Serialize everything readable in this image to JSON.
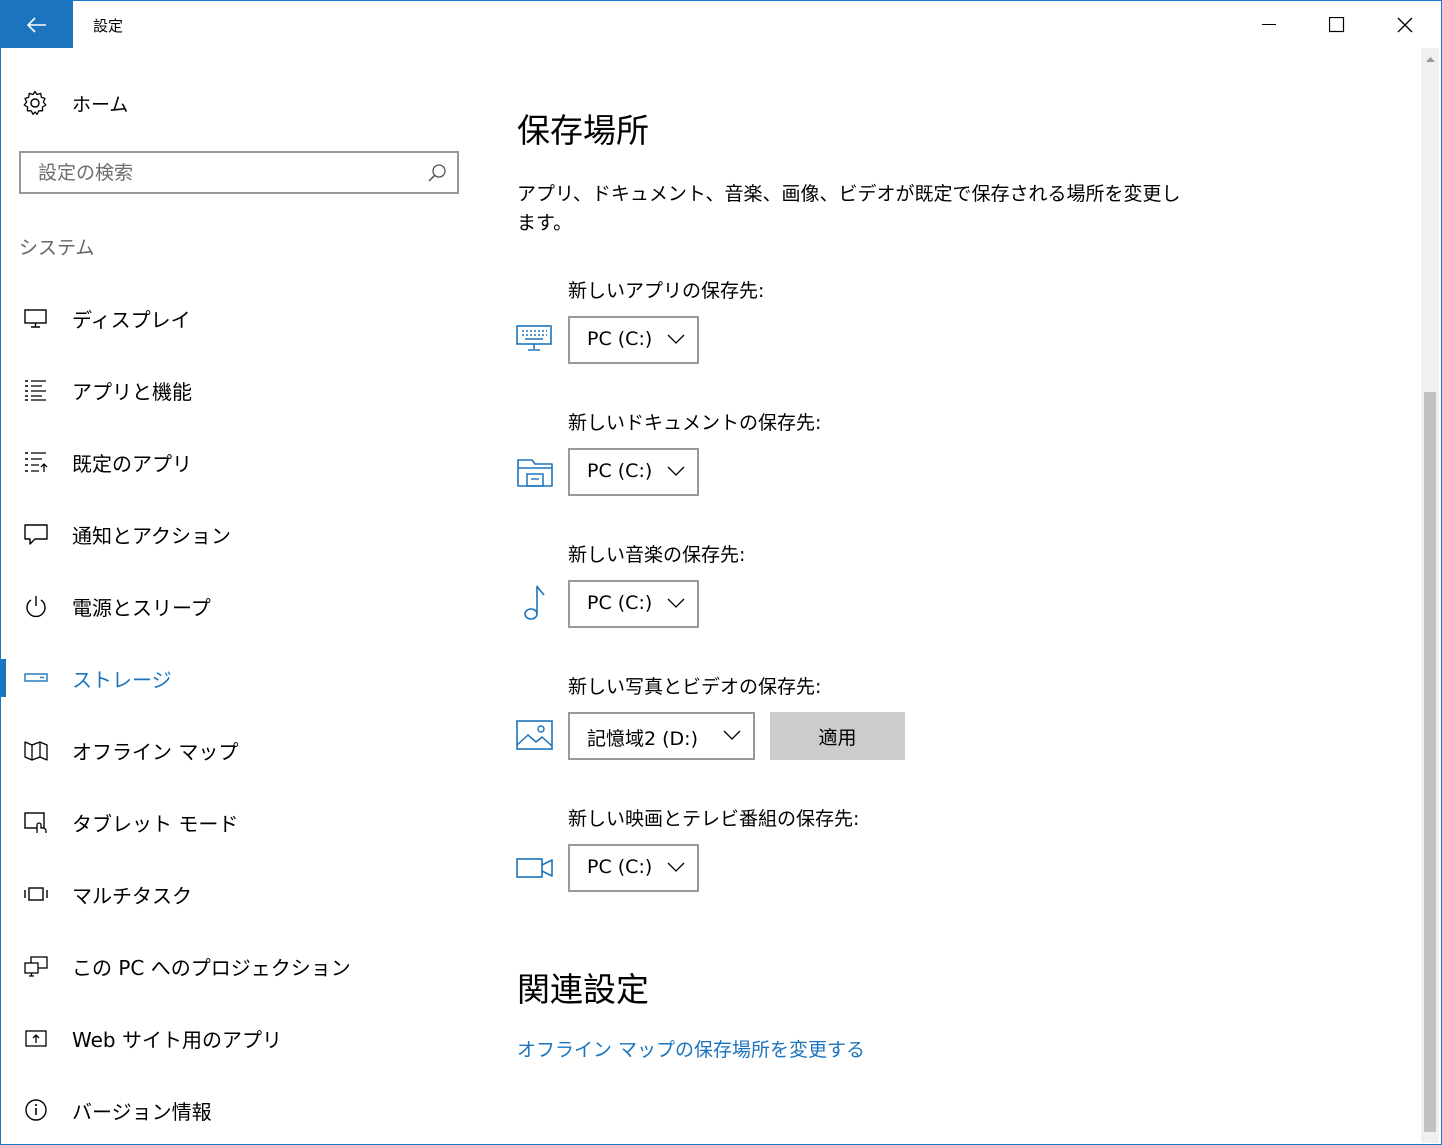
{
  "window": {
    "title": "設定",
    "back_icon": "back-arrow-icon",
    "accent_color": "#1b74bd"
  },
  "sidebar": {
    "home_label": "ホーム",
    "search_placeholder": "設定の検索",
    "section_label": "システム",
    "items": [
      {
        "label": "ディスプレイ",
        "icon": "monitor-icon",
        "active": false
      },
      {
        "label": "アプリと機能",
        "icon": "list-icon",
        "active": false
      },
      {
        "label": "既定のアプリ",
        "icon": "default-apps-icon",
        "active": false
      },
      {
        "label": "通知とアクション",
        "icon": "speech-bubble-icon",
        "active": false
      },
      {
        "label": "電源とスリープ",
        "icon": "power-icon",
        "active": false
      },
      {
        "label": "ストレージ",
        "icon": "drive-icon",
        "active": true
      },
      {
        "label": "オフライン マップ",
        "icon": "map-icon",
        "active": false
      },
      {
        "label": "タブレット モード",
        "icon": "tablet-icon",
        "active": false
      },
      {
        "label": "マルチタスク",
        "icon": "multitask-icon",
        "active": false
      },
      {
        "label": "この PC へのプロジェクション",
        "icon": "projection-icon",
        "active": false
      },
      {
        "label": "Web サイト用のアプリ",
        "icon": "web-app-icon",
        "active": false
      },
      {
        "label": "バージョン情報",
        "icon": "info-icon",
        "active": false
      }
    ]
  },
  "main": {
    "title": "保存場所",
    "description": "アプリ、ドキュメント、音楽、画像、ビデオが既定で保存される場所を変更します。",
    "settings": [
      {
        "label": "新しいアプリの保存先:",
        "icon": "keyboard-icon",
        "value": "PC (C:)"
      },
      {
        "label": "新しいドキュメントの保存先:",
        "icon": "documents-drawer-icon",
        "value": "PC (C:)"
      },
      {
        "label": "新しい音楽の保存先:",
        "icon": "music-note-icon",
        "value": "PC (C:)"
      },
      {
        "label": "新しい写真とビデオの保存先:",
        "icon": "picture-icon",
        "value": "記憶域2 (D:)"
      },
      {
        "label": "新しい映画とテレビ番組の保存先:",
        "icon": "video-camera-icon",
        "value": "PC (C:)"
      }
    ],
    "apply_label": "適用",
    "related_title": "関連設定",
    "related_link": "オフライン マップの保存場所を変更する"
  }
}
